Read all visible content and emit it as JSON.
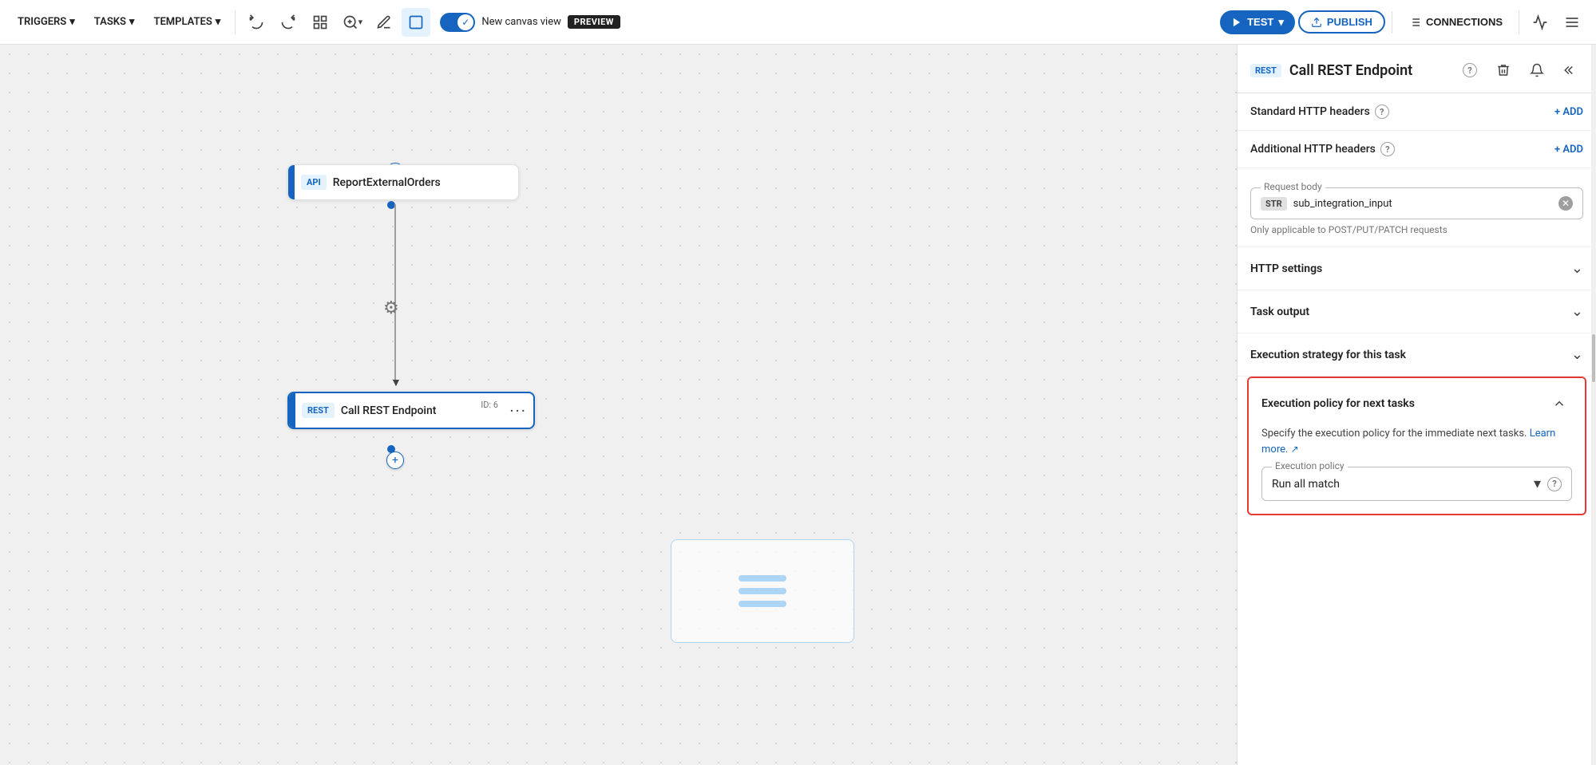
{
  "nav": {
    "triggers_label": "TRIGGERS",
    "tasks_label": "TASKS",
    "templates_label": "TEMPLATES",
    "test_label": "TEST",
    "publish_label": "PUBLISH",
    "connections_label": "CONNECTIONS",
    "canvas_label": "New canvas view",
    "preview_label": "PREVIEW"
  },
  "canvas": {
    "api_node": {
      "badge": "API",
      "name": "ReportExternalOrders"
    },
    "rest_node": {
      "badge": "REST",
      "name": "Call REST Endpoint",
      "id": "ID: 6"
    }
  },
  "panel": {
    "badge": "REST",
    "title": "Call REST Endpoint",
    "standard_http_label": "Standard HTTP headers",
    "additional_http_label": "Additional HTTP headers",
    "add_label": "+ ADD",
    "request_body_label": "Request body",
    "str_badge": "STR",
    "body_value": "sub_integration_input",
    "body_note": "Only applicable to POST/PUT/PATCH requests",
    "http_settings_label": "HTTP settings",
    "task_output_label": "Task output",
    "exec_strategy_label": "Execution strategy for this task",
    "exec_policy_next_label": "Execution policy for next tasks",
    "exec_policy_desc": "Specify the execution policy for the immediate next tasks.",
    "learn_more_label": "Learn more.",
    "exec_policy_dropdown_label": "Execution policy",
    "exec_policy_value": "Run all match"
  }
}
